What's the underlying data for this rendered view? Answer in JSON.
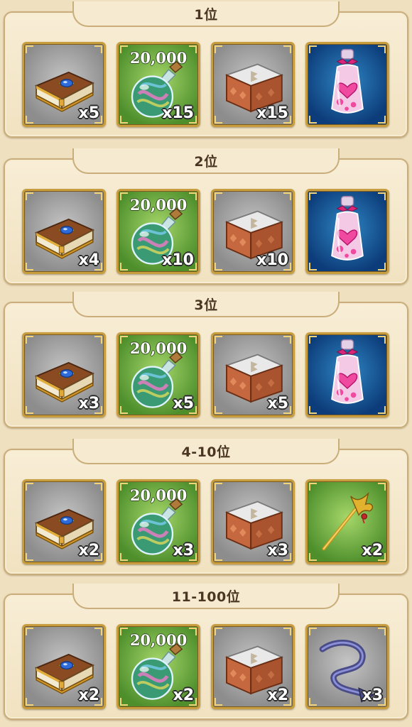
{
  "tiers": [
    {
      "rank": "1位",
      "rewards": [
        {
          "icon": "book-icon",
          "qty": "x5"
        },
        {
          "icon": "potion-flask-icon",
          "amount": "20,000",
          "qty": "x15"
        },
        {
          "icon": "treasure-chest-icon",
          "qty": "x15"
        },
        {
          "icon": "heart-perfume-bottle-icon",
          "qty": ""
        }
      ]
    },
    {
      "rank": "2位",
      "rewards": [
        {
          "icon": "book-icon",
          "qty": "x4"
        },
        {
          "icon": "potion-flask-icon",
          "amount": "20,000",
          "qty": "x10"
        },
        {
          "icon": "treasure-chest-icon",
          "qty": "x10"
        },
        {
          "icon": "heart-perfume-bottle-icon",
          "qty": ""
        }
      ]
    },
    {
      "rank": "3位",
      "rewards": [
        {
          "icon": "book-icon",
          "qty": "x3"
        },
        {
          "icon": "potion-flask-icon",
          "amount": "20,000",
          "qty": "x5"
        },
        {
          "icon": "treasure-chest-icon",
          "qty": "x5"
        },
        {
          "icon": "heart-perfume-bottle-icon",
          "qty": ""
        }
      ]
    },
    {
      "rank": "4-10位",
      "rewards": [
        {
          "icon": "book-icon",
          "qty": "x2"
        },
        {
          "icon": "potion-flask-icon",
          "amount": "20,000",
          "qty": "x3"
        },
        {
          "icon": "treasure-chest-icon",
          "qty": "x3"
        },
        {
          "icon": "golden-staff-icon",
          "qty": "x2"
        }
      ]
    },
    {
      "rank": "11-100位",
      "rewards": [
        {
          "icon": "book-icon",
          "qty": "x2"
        },
        {
          "icon": "potion-flask-icon",
          "amount": "20,000",
          "qty": "x2"
        },
        {
          "icon": "treasure-chest-icon",
          "qty": "x2"
        },
        {
          "icon": "devil-tail-icon",
          "qty": "x3"
        }
      ]
    }
  ]
}
